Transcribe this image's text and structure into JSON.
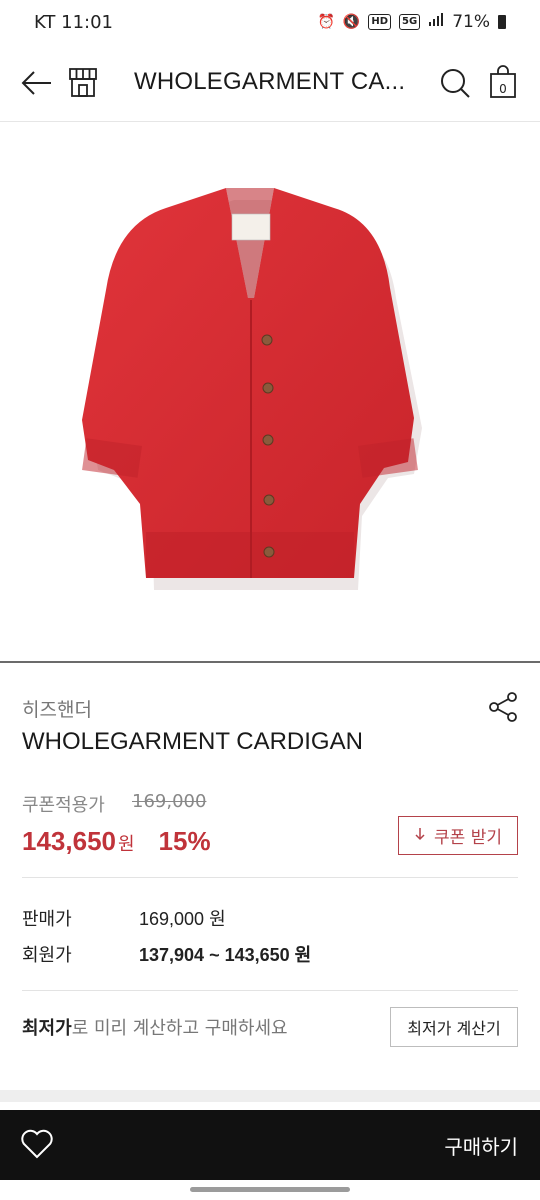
{
  "status_bar": {
    "carrier_time": "KT 11:01",
    "hd_badge": "HD",
    "network_badge": "5G",
    "battery_percent": "71%"
  },
  "header": {
    "title": "WHOLEGARMENT CA...",
    "cart_count": "0",
    "icons": [
      "back-arrow-icon",
      "store-icon",
      "search-icon",
      "shopping-bag-icon"
    ]
  },
  "product": {
    "brand": "히즈핸더",
    "name": "WHOLEGARMENT CARDIGAN",
    "image_color": "#d42a2e"
  },
  "pricing": {
    "coupon_label": "쿠폰적용가",
    "original_price": "169,000",
    "sale_price": "143,650",
    "sale_unit": "원",
    "discount": "15%",
    "coupon_button": "쿠폰 받기"
  },
  "details": {
    "rows": [
      {
        "label": "판매가",
        "value": "169,000 원"
      },
      {
        "label": "회원가",
        "value": "137,904 ~ 143,650 원"
      }
    ]
  },
  "lowest_price": {
    "bold_text": "최저가",
    "text": "로 미리 계산하고 구매하세요",
    "button": "최저가 계산기"
  },
  "bottom_bar": {
    "buy_label": "구매하기"
  },
  "colors": {
    "accent_red": "#c0333a",
    "bottom_bar": "#111111"
  }
}
